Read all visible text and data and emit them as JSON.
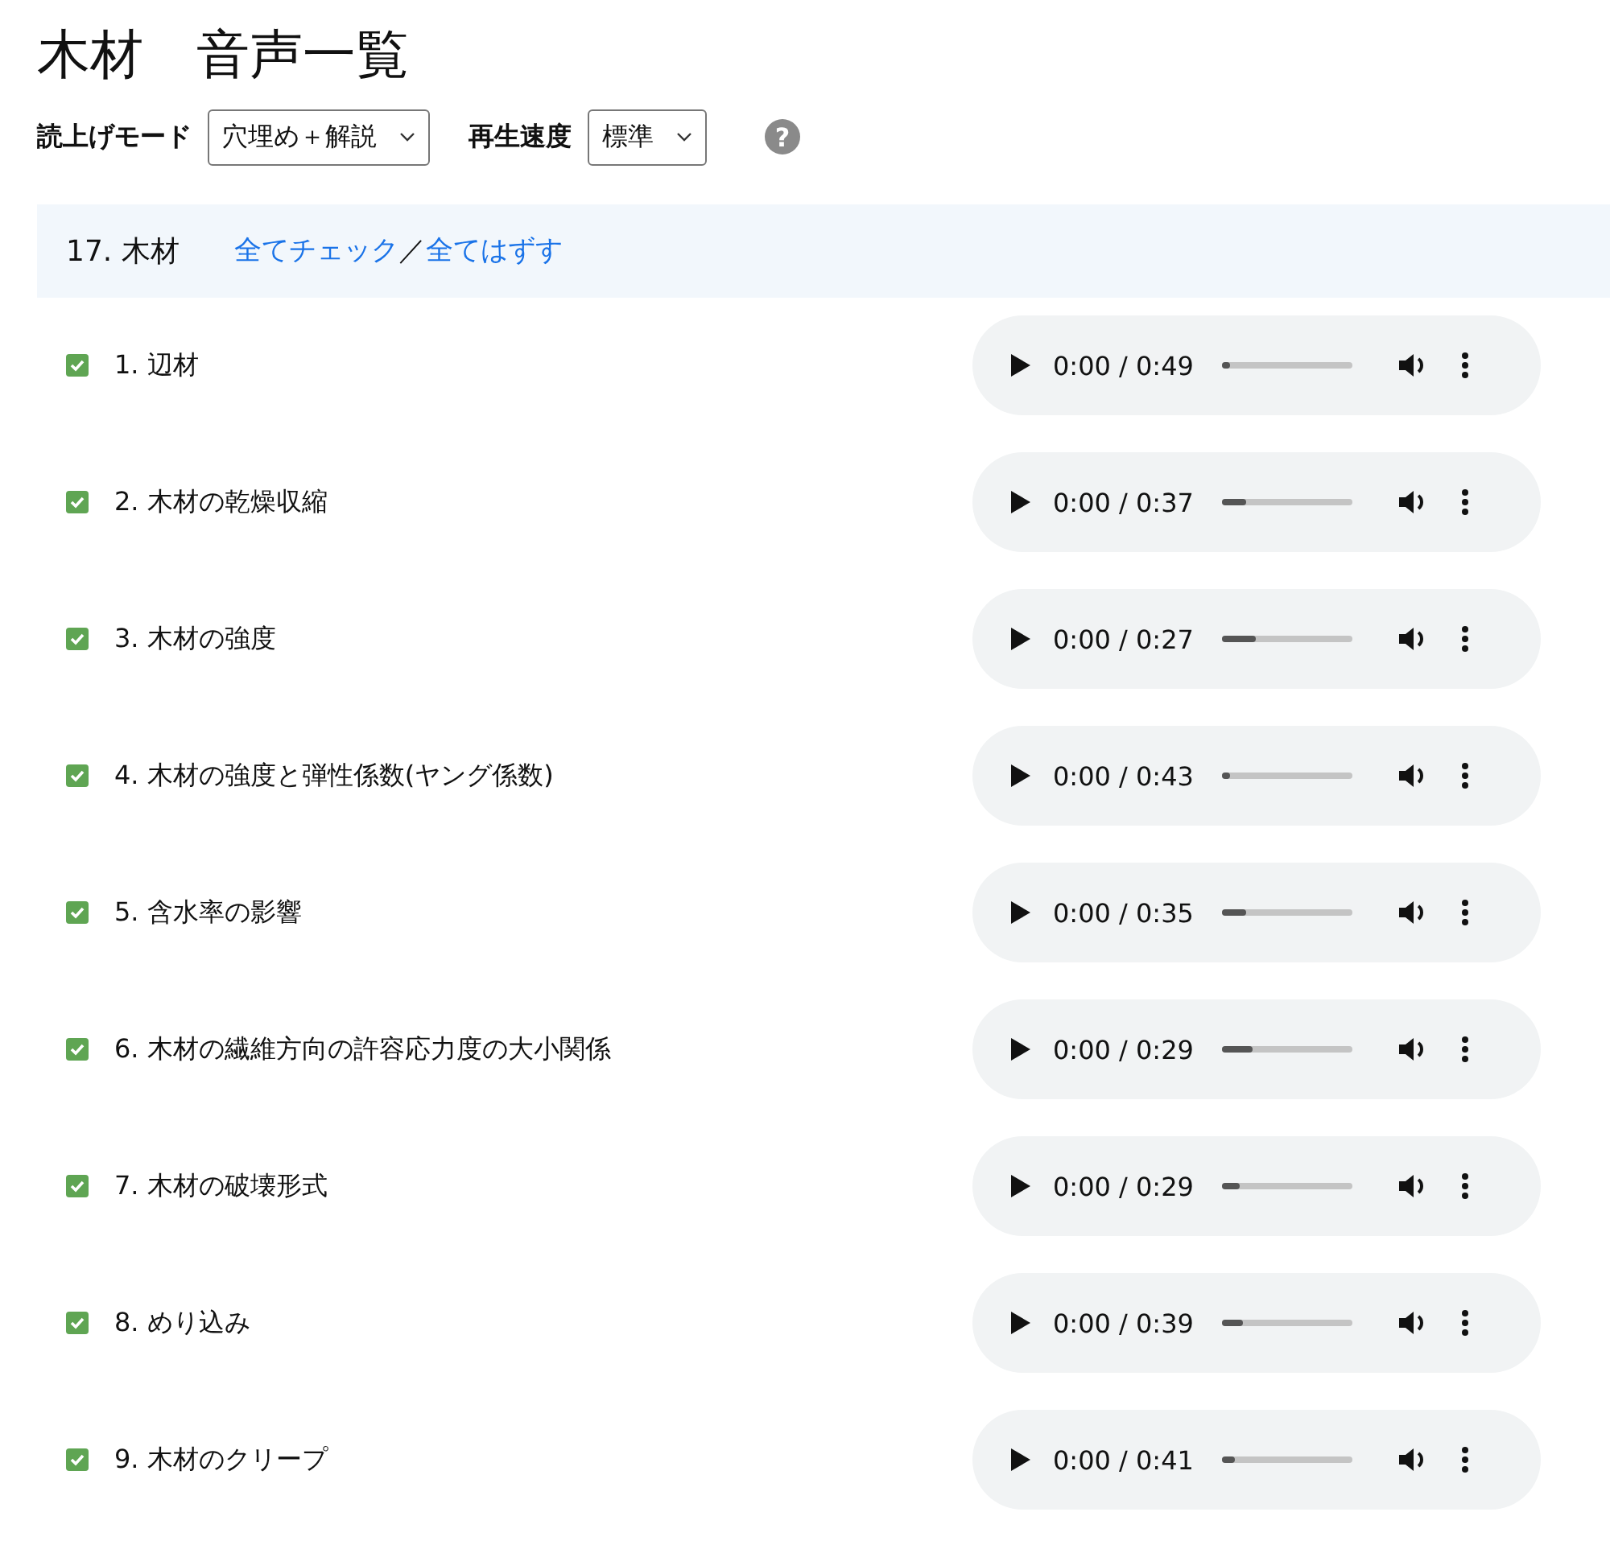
{
  "title": "木材　音声一覧",
  "controls": [
    {
      "label": "読上げモード",
      "value": "穴埋め＋解説"
    },
    {
      "label": "再生速度",
      "value": "標準"
    }
  ],
  "help": {
    "icon": "?"
  },
  "section": {
    "heading": "17. 木材",
    "links": [
      "全てチェック",
      "全てはずす"
    ],
    "separator": "／"
  },
  "items": [
    {
      "label": "1. 辺材",
      "checked": true,
      "time": "0:00 / 0:49",
      "level": 0.06
    },
    {
      "label": "2. 木材の乾燥収縮",
      "checked": true,
      "time": "0:00 / 0:37",
      "level": 0.18
    },
    {
      "label": "3. 木材の強度",
      "checked": true,
      "time": "0:00 / 0:27",
      "level": 0.26
    },
    {
      "label": "4. 木材の強度と弾性係数(ヤング係数)",
      "checked": true,
      "time": "0:00 / 0:43",
      "level": 0.06
    },
    {
      "label": "5. 含水率の影響",
      "checked": true,
      "time": "0:00 / 0:35",
      "level": 0.18
    },
    {
      "label": "6. 木材の繊維方向の許容応力度の大小関係",
      "checked": true,
      "time": "0:00 / 0:29",
      "level": 0.23
    },
    {
      "label": "7. 木材の破壊形式",
      "checked": true,
      "time": "0:00 / 0:29",
      "level": 0.13
    },
    {
      "label": "8. めり込み",
      "checked": true,
      "time": "0:00 / 0:39",
      "level": 0.15
    },
    {
      "label": "9. 木材のクリープ",
      "checked": true,
      "time": "0:00 / 0:41",
      "level": 0.09
    }
  ]
}
